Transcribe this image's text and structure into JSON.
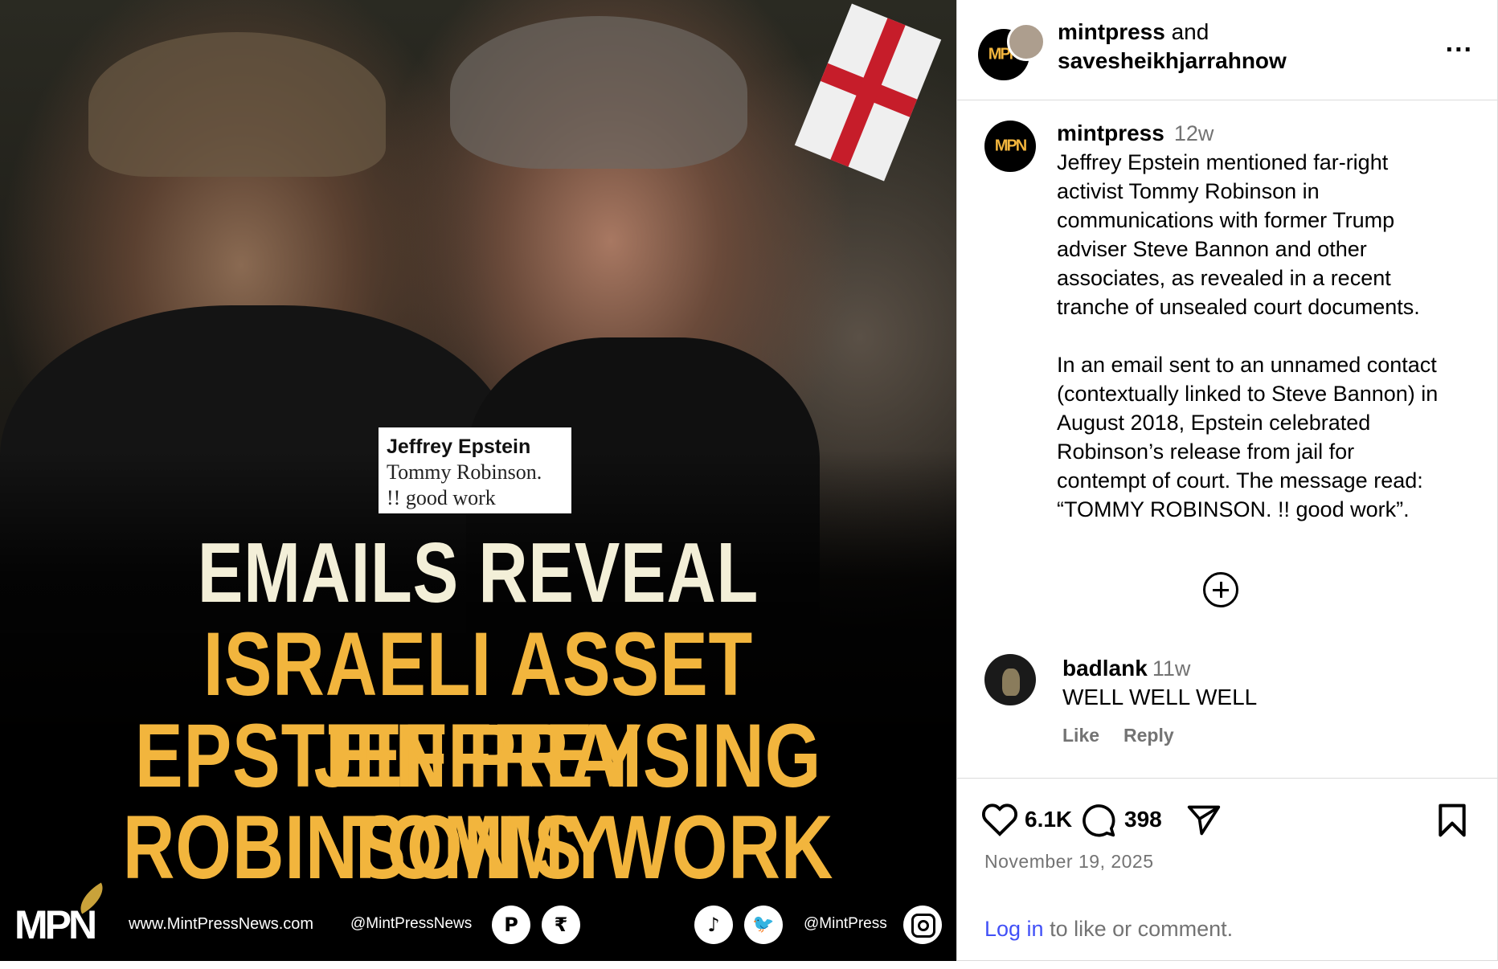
{
  "media": {
    "quote": {
      "line1": "Jeffrey Epstein",
      "line2": "Tommy Robinson.",
      "line3": "!! good work"
    },
    "headline": {
      "line1": "EMAILS REVEAL",
      "line2": "ISRAELI ASSET JEFFREY",
      "line3": "EPSTEIN PRAISING TOMMY",
      "line4": "ROBINSON'S WORK"
    },
    "footer": {
      "logo_a": "M",
      "logo_b": "PN",
      "website": "www.MintPressNews.com",
      "handle1": "@MintPressNews",
      "handle2": "@MintPress",
      "icons": [
        "patreon-icon",
        "rumble-icon",
        "tiktok-icon",
        "twitter-icon",
        "instagram-icon"
      ],
      "patreon_glyph": "P",
      "rumble_glyph": "₹",
      "tiktok_glyph": "♪",
      "twitter_glyph": "🐦"
    },
    "colors": {
      "headline_yellow": "#f2b53d",
      "headline_cream": "#f3efd8",
      "background": "#0b0b0b"
    }
  },
  "header": {
    "author1": "mintpress",
    "joiner": "and",
    "author2": "savesheikhjarrahnow",
    "avatar_text": "MPN",
    "more_label": "..."
  },
  "caption": {
    "username": "mintpress",
    "time": "12w",
    "avatar_text": "MPN",
    "paragraph1": "Jeffrey Epstein mentioned far-right\nactivist Tommy Robinson in\ncommunications with former Trump\nadviser Steve Bannon and other\nassociates, as revealed in a recent\ntranche of unsealed court documents.",
    "paragraph2": "In an email sent to an unnamed contact\n(contextually linked to Steve Bannon) in\nAugust 2018, Epstein celebrated\nRobinson’s release from jail for\ncontempt of court. The message read:\n“TOMMY ROBINSON. !! good work”."
  },
  "comment": {
    "username": "badlank",
    "time": "11w",
    "text": "WELL WELL WELL",
    "like": "Like",
    "reply": "Reply"
  },
  "actions": {
    "likes": "6.1K",
    "comments": "398",
    "date": "November 19, 2025",
    "login_link": "Log in",
    "login_rest": " to like or comment."
  }
}
